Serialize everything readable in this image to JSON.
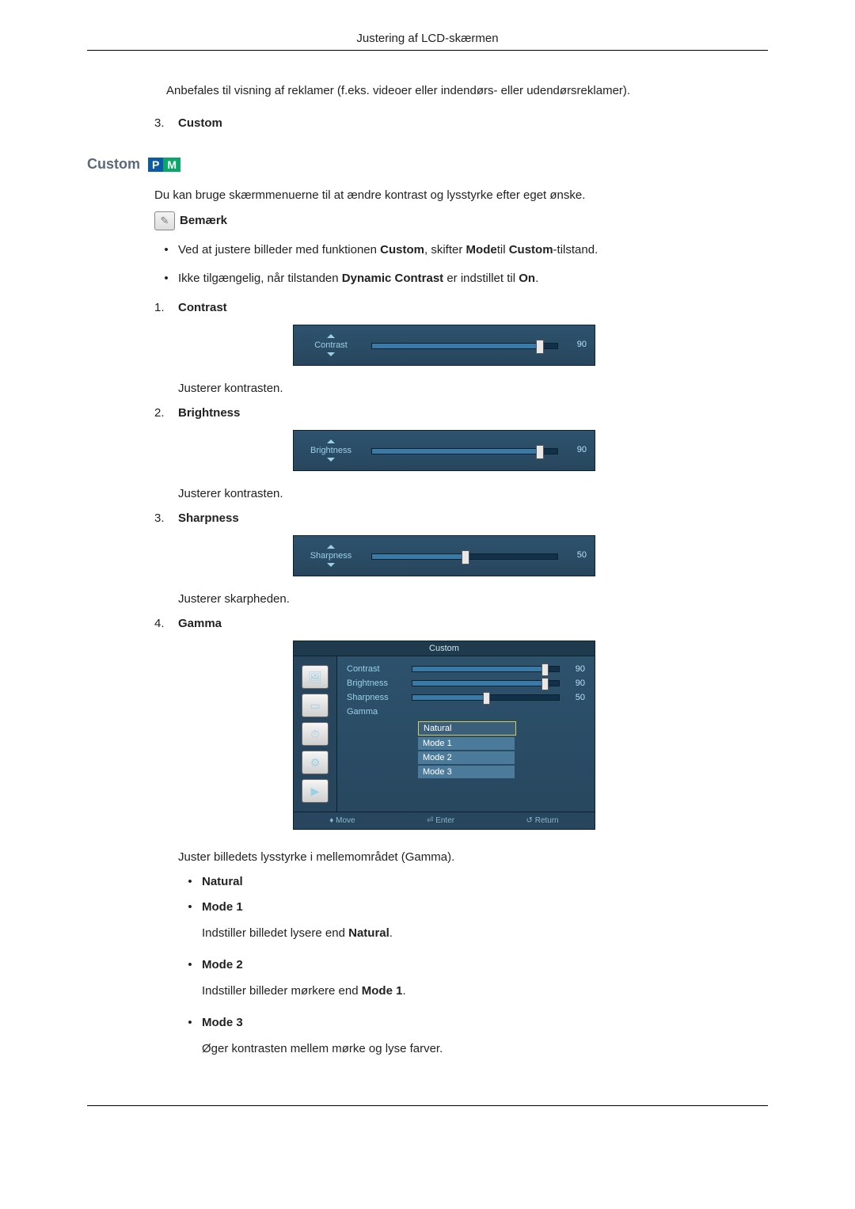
{
  "header": {
    "title": "Justering af LCD-skærmen"
  },
  "intro_paragraph": "Anbefales til visning af reklamer (f.eks. videoer eller indendørs- eller udendørsreklamer).",
  "prior_item": {
    "num": "3.",
    "label": "Custom"
  },
  "section": {
    "title": "Custom",
    "badge_p": "P",
    "badge_m": "M"
  },
  "section_intro": "Du kan bruge skærmmenuerne til at ændre kontrast og lysstyrke efter eget ønske.",
  "note_label": "Bemærk",
  "bullets": [
    {
      "pre": "Ved at justere billeder med funktionen ",
      "b1": "Custom",
      "mid": ", skifter ",
      "b2": "Mode",
      "mid2": "til ",
      "b3": "Custom",
      "post": "-tilstand."
    },
    {
      "pre": "Ikke tilgængelig, når tilstanden ",
      "b1": "Dynamic Contrast",
      "mid": " er indstillet til ",
      "b2": "On",
      "post": "."
    }
  ],
  "items": {
    "contrast": {
      "num": "1.",
      "label": "Contrast",
      "slider_label": "Contrast",
      "value": "90",
      "fill_pct": 90,
      "desc": "Justerer kontrasten."
    },
    "brightness": {
      "num": "2.",
      "label": "Brightness",
      "slider_label": "Brightness",
      "value": "90",
      "fill_pct": 90,
      "desc": "Justerer kontrasten."
    },
    "sharpness": {
      "num": "3.",
      "label": "Sharpness",
      "slider_label": "Sharpness",
      "value": "50",
      "fill_pct": 50,
      "desc": "Justerer skarpheden."
    },
    "gamma": {
      "num": "4.",
      "label": "Gamma",
      "desc": "Juster billedets lysstyrke i mellemområdet (Gamma)."
    }
  },
  "gamma_menu": {
    "title": "Custom",
    "rows": {
      "contrast": {
        "label": "Contrast",
        "value": "90",
        "fill_pct": 90
      },
      "brightness": {
        "label": "Brightness",
        "value": "90",
        "fill_pct": 90
      },
      "sharpness": {
        "label": "Sharpness",
        "value": "50",
        "fill_pct": 50
      },
      "gamma": {
        "label": "Gamma"
      }
    },
    "options": {
      "sel": "Natural",
      "o1": "Mode 1",
      "o2": "Mode 2",
      "o3": "Mode 3"
    },
    "footer": {
      "move": "Move",
      "enter": "Enter",
      "ret": "Return"
    }
  },
  "gamma_modes": {
    "natural": {
      "label": "Natural"
    },
    "mode1": {
      "label": "Mode 1",
      "desc_pre": "Indstiller billedet lysere end ",
      "desc_bold": "Natural",
      "desc_post": "."
    },
    "mode2": {
      "label": "Mode 2",
      "desc_pre": "Indstiller billeder mørkere end ",
      "desc_bold": "Mode 1",
      "desc_post": "."
    },
    "mode3": {
      "label": "Mode 3",
      "desc": "Øger kontrasten mellem mørke og lyse farver."
    }
  }
}
